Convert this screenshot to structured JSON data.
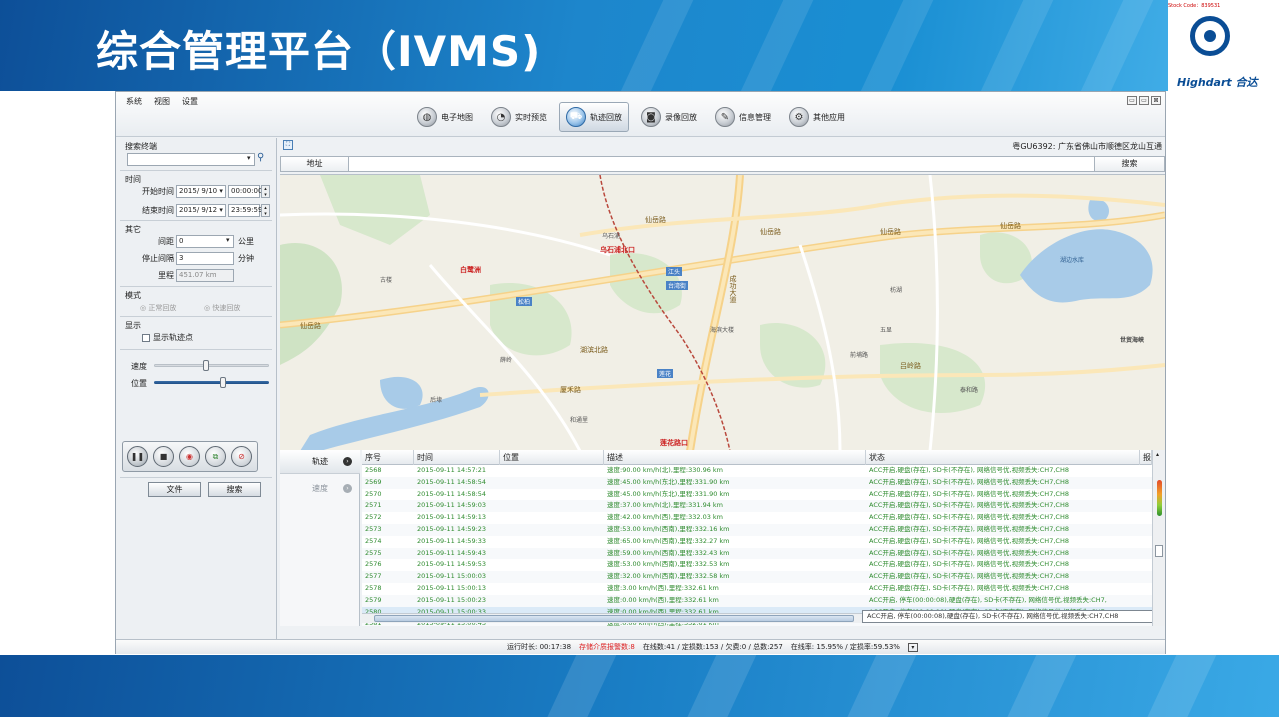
{
  "slide": {
    "title": "综合管理平台（IVMS)",
    "stock_code": "Stock Code：839531",
    "logo_text": "Highdart 合达"
  },
  "menu": {
    "items": [
      "系统",
      "视图",
      "设置"
    ]
  },
  "window_controls": [
    "▭",
    "▭",
    "⊠"
  ],
  "toolbar": {
    "buttons": [
      {
        "label": "电子地图",
        "icon": "globe-icon"
      },
      {
        "label": "实时预览",
        "icon": "camera-icon"
      },
      {
        "label": "轨迹回放",
        "icon": "truck-icon",
        "active": true
      },
      {
        "label": "录像回放",
        "icon": "film-icon"
      },
      {
        "label": "信息管理",
        "icon": "wrench-icon"
      },
      {
        "label": "其他应用",
        "icon": "gear-icon"
      }
    ]
  },
  "left_panel": {
    "search_header": "搜索终端",
    "search_value": "",
    "time_header": "时间",
    "start_label": "开始时间",
    "start_date": "2015/ 9/10 ▾",
    "start_time": "00:00:00",
    "end_label": "结束时间",
    "end_date": "2015/ 9/12 ▾",
    "end_time": "23:59:59",
    "other_header": "其它",
    "distance_label": "间距",
    "distance_value": "0",
    "distance_unit": "公里",
    "stop_label": "停止间隔",
    "stop_value": "3",
    "stop_unit": "分钟",
    "mileage_label": "里程",
    "mileage_value": "451.07 km",
    "mode_header": "模式",
    "mode_normal": "◎ 正常回放",
    "mode_fast": "◎ 快速回放",
    "display_header": "显示",
    "show_track_points": "显示轨迹点",
    "speed_label": "速度",
    "position_label": "位置",
    "speed_level": 0.45,
    "position_level": 0.6,
    "file_button": "文件",
    "search_button": "搜索"
  },
  "address_bar": {
    "location": "粤GU6392: 广东省佛山市顺德区龙山互通",
    "address_label": "地址",
    "address_value": "",
    "search_button": "搜索"
  },
  "map": {
    "roads": [
      "仙岳路",
      "仙岳路",
      "仙岳路",
      "仙岳路",
      "仙岳路",
      "吕岭路",
      "成功大道",
      "厦禾路",
      "湖滨北路"
    ],
    "places": [
      "湖边水库",
      "乌石浦",
      "江头",
      "台湾街",
      "松柏",
      "莲花",
      "海滨大楼",
      "前埔路",
      "世贸海峡",
      "枋湖",
      "五显",
      "后埭",
      "古楼",
      "薛岭",
      "泰和路",
      "和通里"
    ],
    "markers": [
      "白鹭洲",
      "乌石浦北口",
      "莲花路口"
    ]
  },
  "bottom_tabs": [
    {
      "label": "轨迹",
      "active": true
    },
    {
      "label": "速度",
      "active": false
    }
  ],
  "table": {
    "columns": [
      "序号",
      "时间",
      "位置",
      "描述",
      "状态",
      "报"
    ],
    "rows": [
      {
        "no": "2568",
        "time": "2015-09-11 14:57:21",
        "desc": "速度:90.00 km/h(北),里程:330.96 km",
        "status": "ACC开启,硬盘(存在), SD卡(不存在), 网络信号优,视频丢失:CH7,CH8"
      },
      {
        "no": "2569",
        "time": "2015-09-11 14:58:54",
        "desc": "速度:45.00 km/h(东北),里程:331.90 km",
        "status": "ACC开启,硬盘(存在), SD卡(不存在), 网络信号优,视频丢失:CH7,CH8"
      },
      {
        "no": "2570",
        "time": "2015-09-11 14:58:54",
        "desc": "速度:45.00 km/h(东北),里程:331.90 km",
        "status": "ACC开启,硬盘(存在), SD卡(不存在), 网络信号优,视频丢失:CH7,CH8"
      },
      {
        "no": "2571",
        "time": "2015-09-11 14:59:03",
        "desc": "速度:37.00 km/h(北),里程:331.94 km",
        "status": "ACC开启,硬盘(存在), SD卡(不存在), 网络信号优,视频丢失:CH7,CH8"
      },
      {
        "no": "2572",
        "time": "2015-09-11 14:59:13",
        "desc": "速度:42.00 km/h(西),里程:332.03 km",
        "status": "ACC开启,硬盘(存在), SD卡(不存在), 网络信号优,视频丢失:CH7,CH8"
      },
      {
        "no": "2573",
        "time": "2015-09-11 14:59:23",
        "desc": "速度:53.00 km/h(西南),里程:332.16 km",
        "status": "ACC开启,硬盘(存在), SD卡(不存在), 网络信号优,视频丢失:CH7,CH8"
      },
      {
        "no": "2574",
        "time": "2015-09-11 14:59:33",
        "desc": "速度:65.00 km/h(西南),里程:332.27 km",
        "status": "ACC开启,硬盘(存在), SD卡(不存在), 网络信号优,视频丢失:CH7,CH8"
      },
      {
        "no": "2575",
        "time": "2015-09-11 14:59:43",
        "desc": "速度:59.00 km/h(西南),里程:332.43 km",
        "status": "ACC开启,硬盘(存在), SD卡(不存在), 网络信号优,视频丢失:CH7,CH8"
      },
      {
        "no": "2576",
        "time": "2015-09-11 14:59:53",
        "desc": "速度:53.00 km/h(西南),里程:332.53 km",
        "status": "ACC开启,硬盘(存在), SD卡(不存在), 网络信号优,视频丢失:CH7,CH8"
      },
      {
        "no": "2577",
        "time": "2015-09-11 15:00:03",
        "desc": "速度:32.00 km/h(西南),里程:332.58 km",
        "status": "ACC开启,硬盘(存在), SD卡(不存在), 网络信号优,视频丢失:CH7,CH8"
      },
      {
        "no": "2578",
        "time": "2015-09-11 15:00:13",
        "desc": "速度:3.00 km/h(西),里程:332.61 km",
        "status": "ACC开启,硬盘(存在), SD卡(不存在), 网络信号优,视频丢失:CH7,CH8"
      },
      {
        "no": "2579",
        "time": "2015-09-11 15:00:23",
        "desc": "速度:0.00 km/h(西),里程:332.61 km",
        "status": "ACC开启, 停车(00:00:08),硬盘(存在), SD卡(不存在), 网络信号优,视频丢失:CH7,"
      },
      {
        "no": "2580",
        "time": "2015-09-11 15:00:33",
        "desc": "速度:0.00 km/h(西),里程:332.61 km",
        "status": "ACC开启, 停车(00:00:18),硬盘(存在), SD卡(不存在), 网络信号优,视频丢失:CH7,"
      },
      {
        "no": "2581",
        "time": "2015-09-11 15:00:43",
        "desc": "速度:0.00 km/h(西),里程:332.61 km",
        "status": ""
      }
    ],
    "tooltip": "ACC开启, 停车(00:00:08),硬盘(存在), SD卡(不存在), 网络信号优,视频丢失:CH7,CH8"
  },
  "status_bar": {
    "runtime": "运行时长: 00:17:38",
    "storage_alarm": "存储介质报警数:8",
    "counts": "在线数:41 / 定损数:153 / 欠费:0 / 总数:257",
    "online_rate": "在线率: 15.95% / 定损率:59.53%"
  }
}
